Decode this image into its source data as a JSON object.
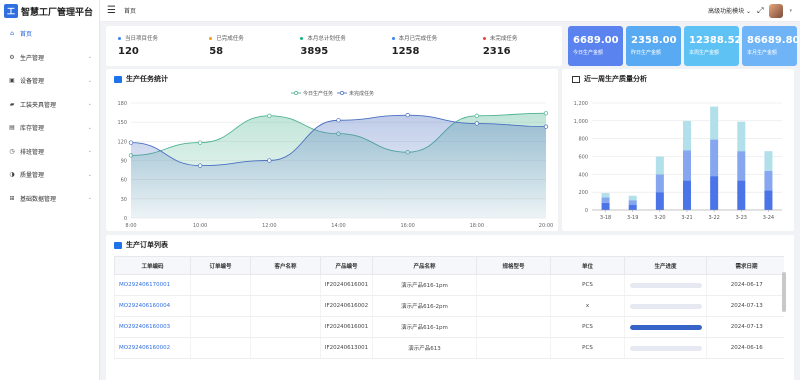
{
  "app": {
    "logo_letter": "工",
    "title": "智慧工厂管理平台"
  },
  "sidebar": {
    "items": [
      {
        "label": "首页",
        "icon": "home-icon",
        "glyph": "⌂",
        "active": true,
        "arrow": ""
      },
      {
        "label": "生产管理",
        "icon": "production-icon",
        "glyph": "⚙",
        "active": false,
        "arrow": "⌄"
      },
      {
        "label": "设备管理",
        "icon": "equipment-icon",
        "glyph": "▣",
        "active": false,
        "arrow": "⌄"
      },
      {
        "label": "工装夹具管理",
        "icon": "fixture-icon",
        "glyph": "▰",
        "active": false,
        "arrow": "⌄"
      },
      {
        "label": "库存管理",
        "icon": "inventory-icon",
        "glyph": "▤",
        "active": false,
        "arrow": "⌄"
      },
      {
        "label": "排班管理",
        "icon": "schedule-icon",
        "glyph": "◷",
        "active": false,
        "arrow": "⌄"
      },
      {
        "label": "质量管理",
        "icon": "quality-icon",
        "glyph": "◑",
        "active": false,
        "arrow": "⌄"
      },
      {
        "label": "基础数据管理",
        "icon": "base-data-icon",
        "glyph": "⊞",
        "active": false,
        "arrow": "⌄"
      }
    ]
  },
  "header": {
    "menu_glyph": "☰",
    "breadcrumb": "首页",
    "advanced": "高级功能模块 ⌄",
    "expand_glyph": "⤢"
  },
  "stats": [
    {
      "label": "当日项目任务",
      "value": "120",
      "color": "#3b82f6"
    },
    {
      "label": "已完成任务",
      "value": "58",
      "color": "#f59e0b"
    },
    {
      "label": "本月总计划任务",
      "value": "3895",
      "color": "#10b981"
    },
    {
      "label": "本月已完成任务",
      "value": "1258",
      "color": "#3b82f6"
    },
    {
      "label": "未完成任务",
      "value": "2316",
      "color": "#ef4444"
    }
  ],
  "tiles": [
    {
      "value": "6689.00",
      "label": "今日生产金额",
      "color": "#5b83f0"
    },
    {
      "value": "2358.00",
      "label": "昨日生产金额",
      "color": "#58aaf2"
    },
    {
      "value": "12388.52",
      "label": "本周生产金额",
      "color": "#5ec3f4"
    },
    {
      "value": "86689.80",
      "label": "本月生产金额",
      "color": "#6fb4f6"
    }
  ],
  "panels": {
    "tasks_title": "生产任务统计",
    "quality_title": "近一周生产质量分析",
    "orders_title": "生产订单列表"
  },
  "chart_data": [
    {
      "type": "area",
      "title": "生产任务统计",
      "x": [
        "8:00",
        "10:00",
        "12:00",
        "14:00",
        "16:00",
        "18:00",
        "20:00"
      ],
      "ylim": [
        0,
        180
      ],
      "yticks": [
        "0",
        "30",
        "60",
        "90",
        "120",
        "150",
        "180"
      ],
      "legend": "top-center",
      "series": [
        {
          "name": "今日生产任务",
          "values": [
            98,
            118,
            160,
            132,
            103,
            160,
            164
          ],
          "color": "#4cb391"
        },
        {
          "name": "未完成任务",
          "values": [
            118,
            82,
            90,
            153,
            161,
            148,
            143
          ],
          "color": "#4a6fc0"
        }
      ]
    },
    {
      "type": "bar",
      "title": "近一周生产质量分析",
      "categories": [
        "3-18",
        "3-19",
        "3-20",
        "3-21",
        "3-22",
        "3-23",
        "3-24"
      ],
      "ylim": [
        0,
        1200
      ],
      "yticks": [
        "0",
        "200",
        "400",
        "600",
        "800",
        "1,000",
        "1,200"
      ],
      "stacked": true,
      "series": [
        {
          "values": [
            80,
            60,
            200,
            330,
            380,
            330,
            220
          ],
          "color": "#4a74e8"
        },
        {
          "values": [
            60,
            50,
            200,
            340,
            410,
            330,
            220
          ],
          "color": "#86a6f0"
        },
        {
          "values": [
            50,
            50,
            200,
            330,
            370,
            330,
            220
          ],
          "color": "#b1e0eb"
        }
      ]
    }
  ],
  "orders": {
    "columns": [
      "工单编码",
      "订单编号",
      "客户名称",
      "产品编号",
      "产品名称",
      "规格型号",
      "单位",
      "生产进度",
      "需求日期"
    ],
    "rows": [
      {
        "code": "MO292406170001",
        "order": "",
        "customer": "",
        "product_no": "IF20240616001",
        "product_name": "演示产品616-1pm",
        "spec": "",
        "unit": "PCS",
        "progress": 0,
        "date": "2024-06-17"
      },
      {
        "code": "MO292406160004",
        "order": "",
        "customer": "",
        "product_no": "IF20240616002",
        "product_name": "演示产品616-2pm",
        "spec": "",
        "unit": "x",
        "progress": 0,
        "date": "2024-07-13"
      },
      {
        "code": "MO292406160003",
        "order": "",
        "customer": "",
        "product_no": "IF20240616001",
        "product_name": "演示产品616-1pm",
        "spec": "",
        "unit": "PCS",
        "progress": 1,
        "date": "2024-07-13"
      },
      {
        "code": "MO292406160002",
        "order": "",
        "customer": "",
        "product_no": "IF20240613001",
        "product_name": "演示产品613",
        "spec": "",
        "unit": "PCS",
        "progress": 0,
        "date": "2024-06-16"
      }
    ]
  }
}
